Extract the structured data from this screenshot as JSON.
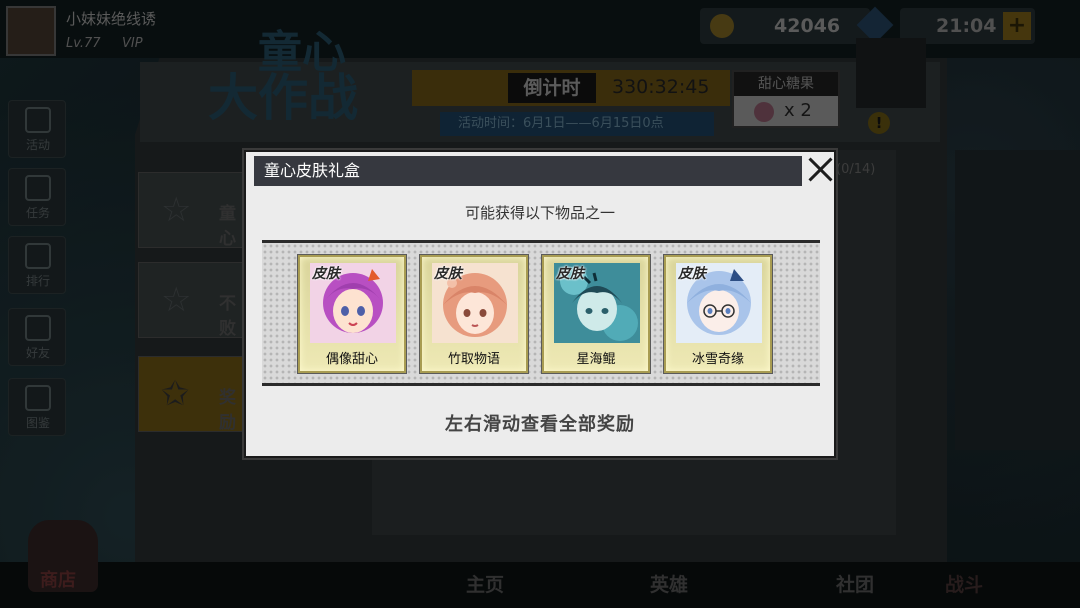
{
  "player": {
    "name": "小妹妹绝线诱",
    "level": "Lv.77",
    "vip": "VIP"
  },
  "resources": {
    "gold": "42046",
    "energy": "21:04",
    "energy_plus": "+"
  },
  "sidebar": {
    "items": [
      {
        "label": "活动",
        "icon": "star-ring-icon"
      },
      {
        "label": "任务",
        "icon": "scroll-icon"
      },
      {
        "label": "排行",
        "icon": "podium-icon"
      },
      {
        "label": "好友",
        "icon": "heart-icon"
      },
      {
        "label": "图鉴",
        "icon": "face-icon"
      }
    ]
  },
  "event": {
    "logo_line1": "童心",
    "logo_line2": "大作战",
    "countdown_label": "倒计时",
    "countdown_value": "330:32:45",
    "time_range": "活动时间：6月1日——6月15日0点",
    "candy_title": "甜心糖果",
    "candy_count": "x 2",
    "progress": "(0/14)",
    "warn": "!"
  },
  "tasks": [
    {
      "label": "童心"
    },
    {
      "label": "不败"
    },
    {
      "label": "奖励"
    }
  ],
  "bottom_nav": {
    "shop": "商店",
    "home": "主页",
    "hero": "英雄",
    "guild": "社团",
    "battle": "战斗"
  },
  "modal": {
    "title": "童心皮肤礼盒",
    "subtitle": "可能获得以下物品之一",
    "hint": "左右滑动查看全部奖励",
    "rewards": [
      {
        "tag": "皮肤",
        "name": "偶像甜心",
        "accent": "#b84fc2"
      },
      {
        "tag": "皮肤",
        "name": "竹取物语",
        "accent": "#e79b7e"
      },
      {
        "tag": "皮肤",
        "name": "星海鲲",
        "accent": "#4fb6c6"
      },
      {
        "tag": "皮肤",
        "name": "冰雪奇缘",
        "accent": "#8fb4e6"
      }
    ]
  }
}
